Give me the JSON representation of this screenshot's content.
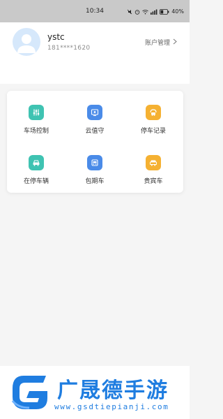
{
  "status_bar": {
    "time": "10:34",
    "battery": "40%",
    "icons": [
      "mute-icon",
      "alarm-icon",
      "wifi-icon",
      "signal-icon",
      "battery-icon"
    ]
  },
  "profile": {
    "username": "ystc",
    "phone": "181****1620",
    "account_label": "账户管理",
    "avatar_color": "#d6e8fb"
  },
  "menu": [
    {
      "label": "车场控制",
      "icon": "control-icon",
      "color": "#3fc3b2"
    },
    {
      "label": "云值守",
      "icon": "cloud-watch-icon",
      "color": "#4a8be8"
    },
    {
      "label": "停车记录",
      "icon": "record-icon",
      "color": "#f5b132"
    },
    {
      "label": "在停车辆",
      "icon": "car-icon",
      "color": "#3fc3b2"
    },
    {
      "label": "包期车",
      "icon": "period-car-icon",
      "color": "#4a8be8"
    },
    {
      "label": "贵宾车",
      "icon": "vip-car-icon",
      "color": "#f5b132"
    }
  ],
  "watermark": {
    "title": "广晟德手游",
    "url": "www.gsdtiepianji.com",
    "brand_color": "#1f7de0"
  }
}
